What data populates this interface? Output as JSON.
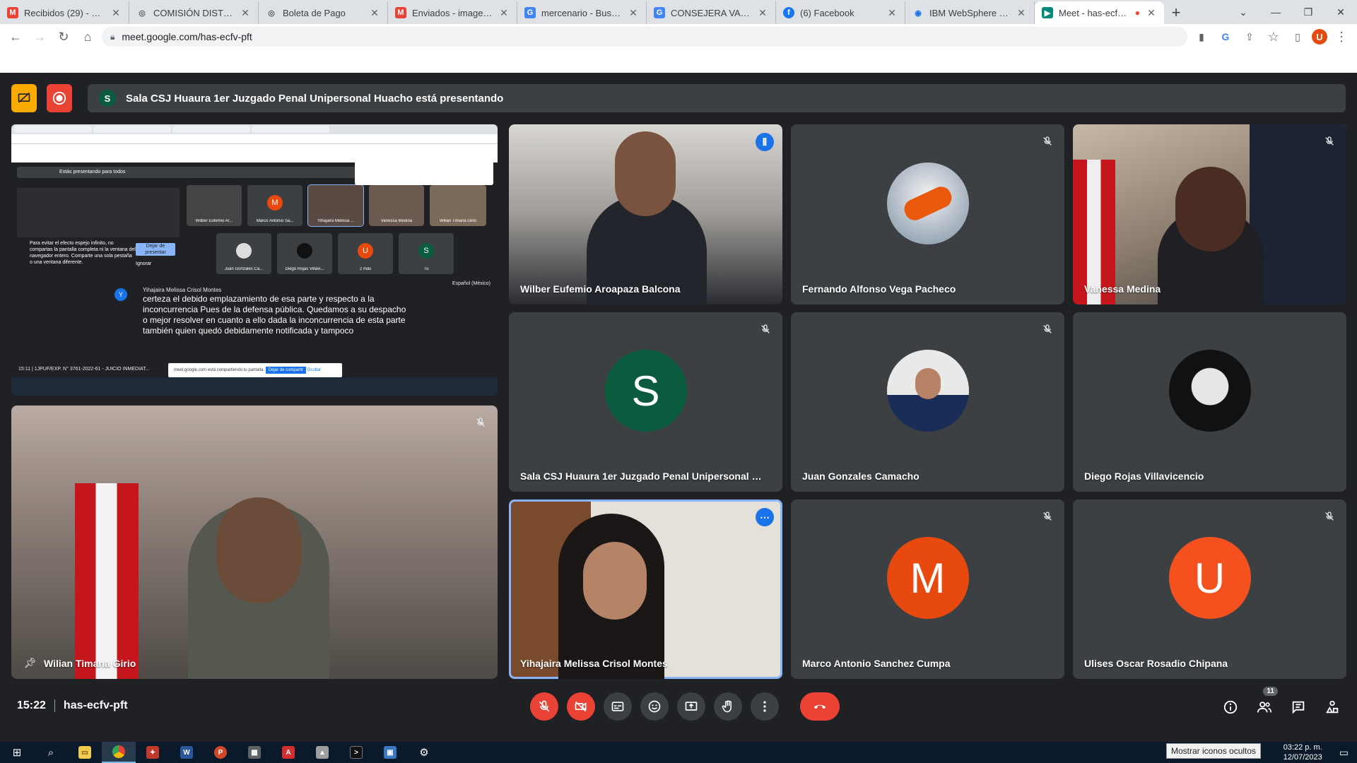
{
  "browser": {
    "tabs": [
      {
        "label": "Recibidos (29) - urosa",
        "fav": "M",
        "color": "#ea4335"
      },
      {
        "label": "COMISIÓN DISTRITAL",
        "fav": "◎",
        "color": "#5f6368"
      },
      {
        "label": "Boleta de Pago",
        "fav": "◎",
        "color": "#5f6368"
      },
      {
        "label": "Enviados - imagencsjh",
        "fav": "M",
        "color": "#ea4335"
      },
      {
        "label": "mercenario - Buscar c",
        "fav": "G",
        "color": "#4285f4"
      },
      {
        "label": "CONSEJERA VANESSA",
        "fav": "G",
        "color": "#4285f4"
      },
      {
        "label": "(6) Facebook",
        "fav": "f",
        "color": "#1877f2"
      },
      {
        "label": "IBM WebSphere Porta",
        "fav": "◉",
        "color": "#1a73e8"
      },
      {
        "label": "Meet - has-ecfv-p",
        "fav": "▶",
        "color": "#00897b"
      }
    ],
    "url": "meet.google.com/has-ecfv-pft"
  },
  "presenting": {
    "initial": "S",
    "text": "Sala CSJ Huaura 1er Juzgado Penal Unipersonal Huacho está presentando"
  },
  "shared_screen": {
    "bar_text": "Estás presentando para todos",
    "tiles": [
      {
        "name": "Wilber Eufemio Ar...",
        "initial": "",
        "color": "#333"
      },
      {
        "name": "Marco Antonio Sa...",
        "initial": "M",
        "color": "#e8490f"
      },
      {
        "name": "Yihajaira Melissa ...",
        "initial": "",
        "color": "#333"
      },
      {
        "name": "Vanessa Medina",
        "initial": "",
        "color": "#333"
      },
      {
        "name": "Wilian Timana Girio",
        "initial": "",
        "color": "#333"
      },
      {
        "name": "Juan Gonzales Ca...",
        "initial": "",
        "color": "#333"
      },
      {
        "name": "Diego Rojas Villavi...",
        "initial": "",
        "color": "#333"
      },
      {
        "name": "2 más",
        "initial": "U",
        "color": "#e8490f"
      },
      {
        "name": "Tú",
        "initial": "S",
        "color": "#0b5b3e"
      }
    ],
    "warning": "Para evitar el efecto espejo infinito, no compartas la pantalla completa ni la ventana del navegador entero. Comparte una sola pestaña o una ventana diferente.",
    "stop_label": "Dejar de presentar",
    "ignore_label": "Ignorar",
    "caption_language": "Español (México)",
    "caption_initial": "Y",
    "caption_speaker": "Yihajaira Melissa Crisol Montes",
    "caption_text": "certeza el debido emplazamiento de esa parte y respecto a la inconcurrencia Pues de la defensa pública. Quedamos a su despacho o mejor resolver en cuanto a ello dada la inconcurrencia de esta parte también quien quedó debidamente notificada y tampoco",
    "footer": "15:11 | 1JPUF/EXP. N° 3761-2022-61 - JUICIO INMEDIAT...",
    "toast_text": "meet.google.com está compartiendo tu pantalla.",
    "toast_stop": "Dejar de compartir",
    "toast_hide": "Ocultar"
  },
  "participants": [
    {
      "id": "wilber",
      "name": "Wilber Eufemio Aroapaza Balcona",
      "status": "speaking"
    },
    {
      "id": "fernando",
      "name": "Fernando Alfonso Vega Pacheco",
      "status": "muted"
    },
    {
      "id": "vanessa",
      "name": "Vanessa Medina",
      "status": "muted"
    },
    {
      "id": "sala",
      "name": "Sala CSJ Huaura 1er Juzgado Penal Unipersonal Hua...",
      "initial": "S",
      "status": "muted"
    },
    {
      "id": "juan",
      "name": "Juan Gonzales Camacho",
      "status": "muted"
    },
    {
      "id": "diego",
      "name": "Diego Rojas Villavicencio",
      "status": "muted"
    },
    {
      "id": "yihajaira",
      "name": "Yihajaira Melissa Crisol Montes",
      "status": "options"
    },
    {
      "id": "marco",
      "name": "Marco Antonio Sanchez Cumpa",
      "initial": "M",
      "status": "muted"
    },
    {
      "id": "ulises",
      "name": "Ulises Oscar Rosadio Chipana",
      "initial": "U",
      "status": "muted"
    },
    {
      "id": "wilian",
      "name": "Wilian Timana Girio",
      "status": "muted"
    }
  ],
  "colors": {
    "sala_avatar": "#0b5b3e",
    "orange_avatar": "#e8490f",
    "ulises_avatar": "#f4511e",
    "accent_blue": "#1a73e8",
    "end_red": "#ea4335"
  },
  "meeting": {
    "time": "15:22",
    "code": "has-ecfv-pft",
    "participant_count": "11"
  },
  "taskbar": {
    "time": "03:22 p. m.",
    "date": "12/07/2023",
    "tooltip": "Mostrar iconos ocultos"
  }
}
